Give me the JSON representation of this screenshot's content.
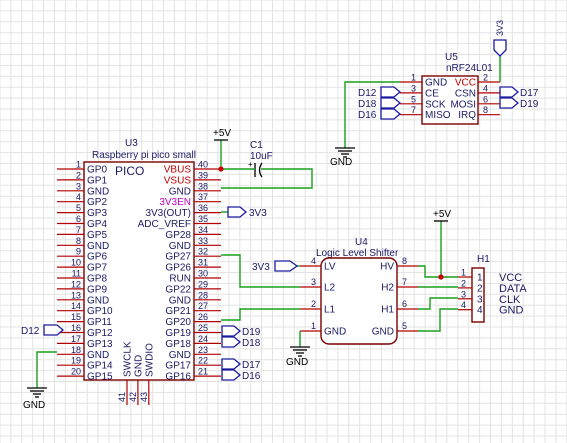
{
  "colors": {
    "wire": "#1aa01a",
    "component_outline": "#7a0000",
    "pin_line": "#b00000",
    "port_outline": "#1a1aa0",
    "text": "#1a1a66",
    "power_pin_text": "#c00000",
    "enable_pin_text": "#c000c0",
    "junction": "#cc0000"
  },
  "u3": {
    "designator": "U3",
    "description": "Raspberry pi pico small",
    "body_label": "PICO",
    "left_pins": [
      {
        "num": "1",
        "name": "GP0"
      },
      {
        "num": "2",
        "name": "GP1"
      },
      {
        "num": "3",
        "name": "GND"
      },
      {
        "num": "4",
        "name": "GP2"
      },
      {
        "num": "5",
        "name": "GP3"
      },
      {
        "num": "6",
        "name": "GP4"
      },
      {
        "num": "7",
        "name": "GP5"
      },
      {
        "num": "8",
        "name": "GND"
      },
      {
        "num": "9",
        "name": "GP6"
      },
      {
        "num": "10",
        "name": "GP7"
      },
      {
        "num": "11",
        "name": "GP8"
      },
      {
        "num": "12",
        "name": "GP9"
      },
      {
        "num": "13",
        "name": "GND"
      },
      {
        "num": "14",
        "name": "GP10"
      },
      {
        "num": "15",
        "name": "GP11"
      },
      {
        "num": "16",
        "name": "GP12"
      },
      {
        "num": "17",
        "name": "GP13"
      },
      {
        "num": "18",
        "name": "GND"
      },
      {
        "num": "19",
        "name": "GP14"
      },
      {
        "num": "20",
        "name": "GP15"
      }
    ],
    "right_pins": [
      {
        "num": "40",
        "name": "VBUS",
        "color": "red"
      },
      {
        "num": "39",
        "name": "VSUS",
        "color": "red"
      },
      {
        "num": "38",
        "name": "GND"
      },
      {
        "num": "37",
        "name": "3V3EN",
        "color": "mag"
      },
      {
        "num": "36",
        "name": "3V3(OUT)"
      },
      {
        "num": "35",
        "name": "ADC_VREF"
      },
      {
        "num": "34",
        "name": "GP28"
      },
      {
        "num": "33",
        "name": "GND"
      },
      {
        "num": "32",
        "name": "GP27"
      },
      {
        "num": "31",
        "name": "GP26"
      },
      {
        "num": "30",
        "name": "RUN"
      },
      {
        "num": "29",
        "name": "GP22"
      },
      {
        "num": "28",
        "name": "GND"
      },
      {
        "num": "27",
        "name": "GP21"
      },
      {
        "num": "26",
        "name": "GP20"
      },
      {
        "num": "25",
        "name": "GP19"
      },
      {
        "num": "24",
        "name": "GP18"
      },
      {
        "num": "23",
        "name": "GND"
      },
      {
        "num": "22",
        "name": "GP17"
      },
      {
        "num": "21",
        "name": "GP16"
      }
    ],
    "bottom_pins": [
      {
        "num": "41",
        "name": "SWCLK"
      },
      {
        "num": "42",
        "name": "GND"
      },
      {
        "num": "43",
        "name": "SWDIO"
      }
    ]
  },
  "u5": {
    "designator": "U5",
    "description": "nRF24L01",
    "left_pins": [
      {
        "num": "1",
        "name": "GND"
      },
      {
        "num": "3",
        "name": "CE"
      },
      {
        "num": "5",
        "name": "SCK"
      },
      {
        "num": "7",
        "name": "MISO"
      }
    ],
    "right_pins": [
      {
        "num": "2",
        "name": "VCC",
        "color": "red"
      },
      {
        "num": "4",
        "name": "CSN"
      },
      {
        "num": "6",
        "name": "MOSI"
      },
      {
        "num": "8",
        "name": "IRQ"
      }
    ]
  },
  "u4": {
    "designator": "U4",
    "description": "Logic Level Shifter",
    "left_pins": [
      {
        "num": "4",
        "name": "LV"
      },
      {
        "num": "3",
        "name": "L2"
      },
      {
        "num": "2",
        "name": "L1"
      },
      {
        "num": "1",
        "name": "GND"
      }
    ],
    "right_pins": [
      {
        "num": "8",
        "name": "HV"
      },
      {
        "num": "7",
        "name": "H2"
      },
      {
        "num": "6",
        "name": "H1"
      },
      {
        "num": "5",
        "name": "GND"
      }
    ]
  },
  "h1": {
    "designator": "H1",
    "pins": [
      {
        "num": "1",
        "name": "VCC"
      },
      {
        "num": "2",
        "name": "DATA"
      },
      {
        "num": "3",
        "name": "CLK"
      },
      {
        "num": "4",
        "name": "GND"
      }
    ]
  },
  "c1": {
    "designator": "C1",
    "value": "10uF"
  },
  "power": {
    "plus5v": "+5V",
    "v33": "3V3",
    "gnd": "GND"
  },
  "nets": {
    "d12": "D12",
    "d16": "D16",
    "d17": "D17",
    "d18": "D18",
    "d19": "D19"
  }
}
